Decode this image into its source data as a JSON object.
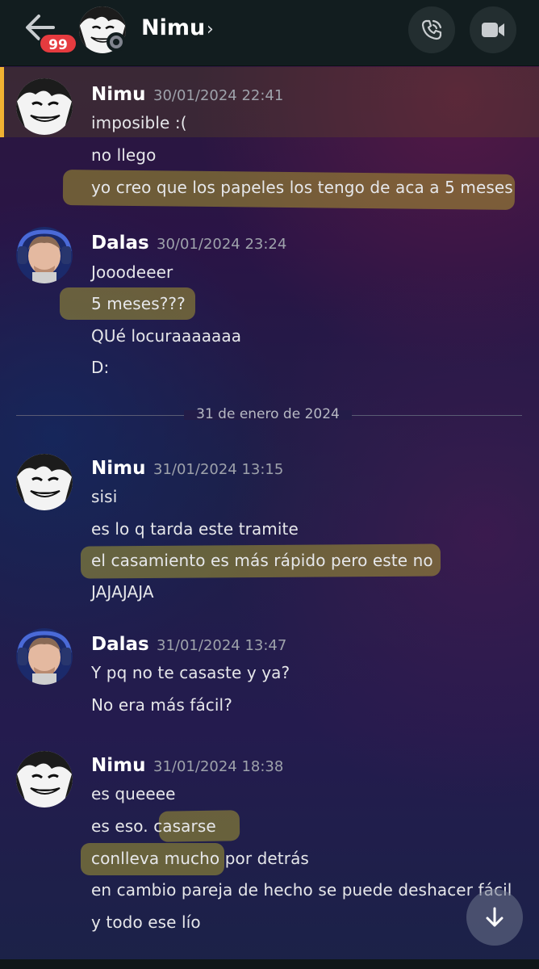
{
  "header": {
    "back_label": "Back",
    "unread_badge": "99",
    "contact_name": "Nimu",
    "chevron": "›",
    "call_icon": "phone-call-icon",
    "video_icon": "video-camera-icon",
    "status": "offline"
  },
  "colors": {
    "header_bg": "#121d1f",
    "badge": "#e53b3f",
    "mention_bar": "#f0b232",
    "highlight": "#cdbe28"
  },
  "messages": [
    {
      "author": "Nimu",
      "timestamp": "30/01/2024 22:41",
      "mentioned": true,
      "lines": [
        "imposible :(",
        "no llego",
        "yo creo que los papeles los tengo de aca a 5 meses"
      ]
    },
    {
      "author": "Dalas",
      "timestamp": "30/01/2024 23:24",
      "lines": [
        "Jooodeeer",
        "5 meses???",
        "QUé locuraaaaaaa",
        "D:"
      ]
    },
    {
      "author": "Nimu",
      "timestamp": "31/01/2024 13:15",
      "lines": [
        "sisi",
        "es lo q tarda este tramite",
        "el casamiento es más rápido pero este no",
        "JAJAJAJA"
      ]
    },
    {
      "author": "Dalas",
      "timestamp": "31/01/2024 13:47",
      "lines": [
        "Y pq no te casaste y ya?",
        "No era más fácil?"
      ]
    },
    {
      "author": "Nimu",
      "timestamp": "31/01/2024 18:38",
      "lines": [
        "es queeee",
        "es eso. casarse",
        "conlleva mucho por detrás",
        "en cambio pareja de hecho se puede deshacer fácil",
        "y todo ese lío"
      ]
    }
  ],
  "date_divider": "31 de enero de 2024",
  "scroll_icon": "arrow-down-icon"
}
